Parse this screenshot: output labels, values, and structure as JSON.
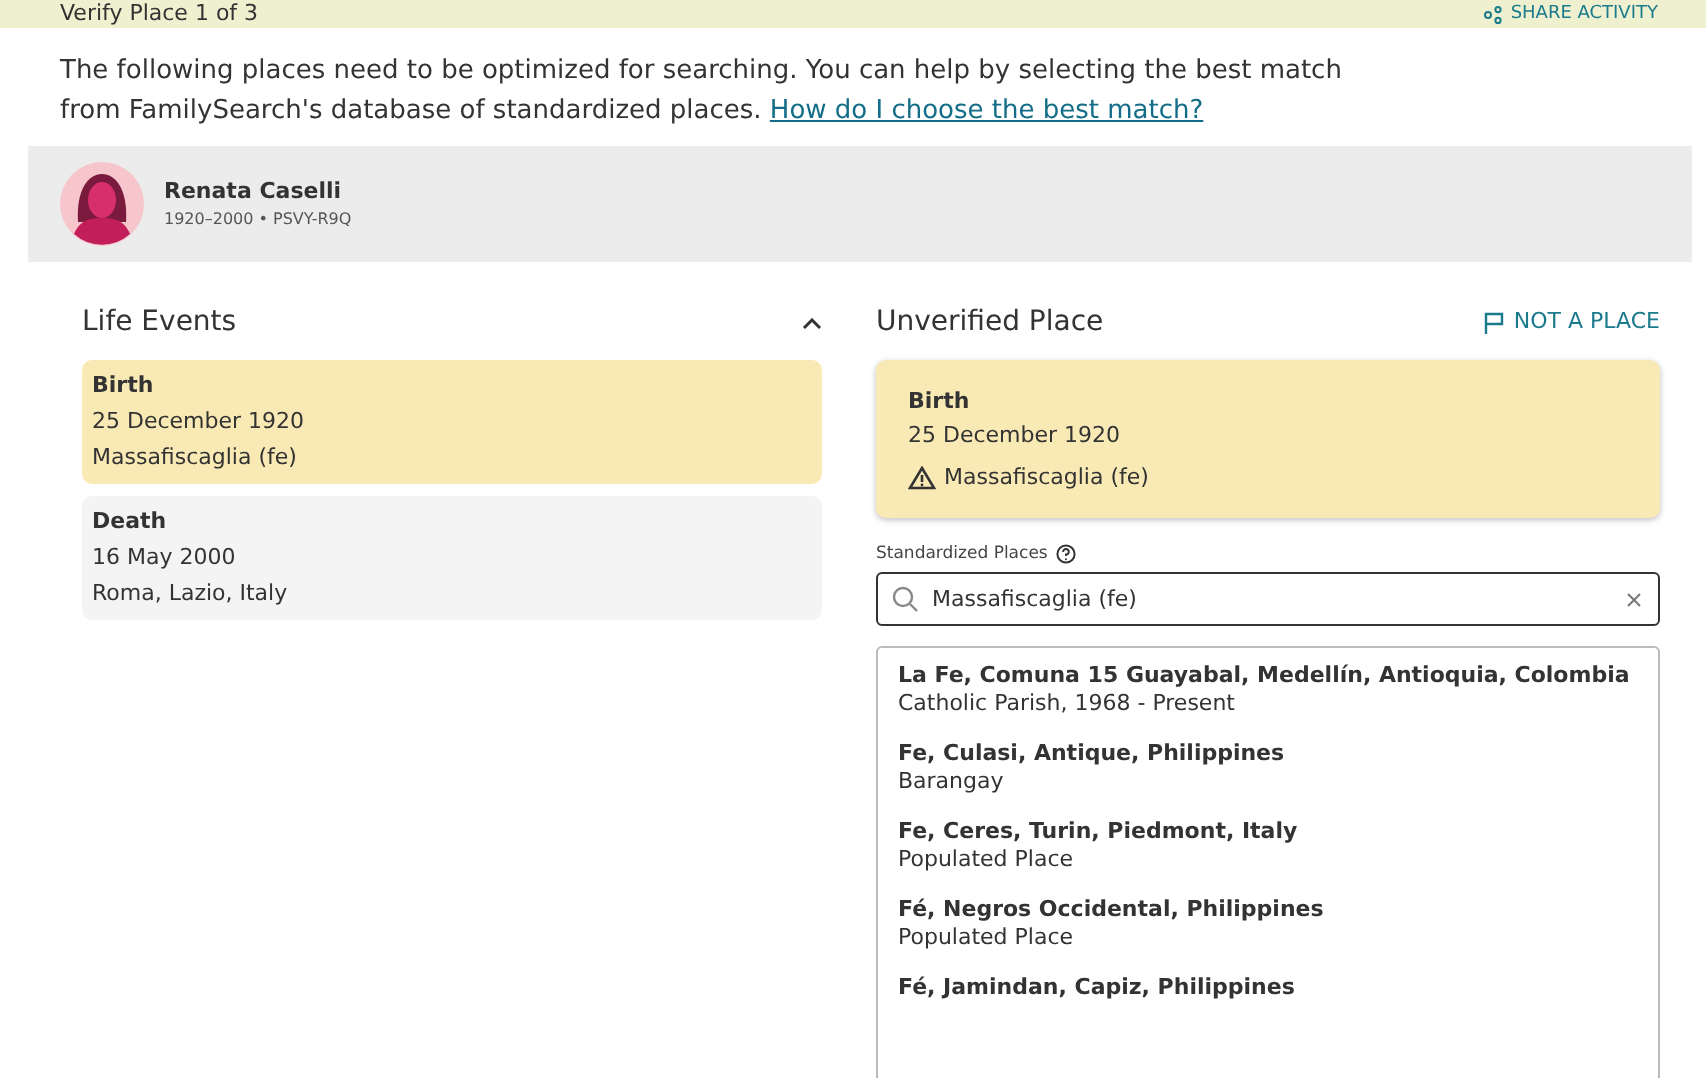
{
  "header": {
    "title": "Verify Place 1 of 3",
    "action": "SHARE ACTIVITY"
  },
  "intro": {
    "text": "The following places need to be optimized for searching. You can help by selecting the best match from FamilySearch's database of standardized places.",
    "link": "How do I choose the best match?"
  },
  "person": {
    "name": "Renata Caselli",
    "details": "1920–2000 • PSVY-R9Q"
  },
  "life_events": {
    "title": "Life Events",
    "expanded": true,
    "items": [
      {
        "type": "Birth",
        "date": "25 December 1920",
        "place": "Massafiscaglia (fe)",
        "selected": true
      },
      {
        "type": "Death",
        "date": "16 May 2000",
        "place": "Roma, Lazio, Italy",
        "selected": false
      }
    ]
  },
  "unverified": {
    "title": "Unverified Place",
    "action": "NOT A PLACE",
    "event": "Birth",
    "date": "25 December 1920",
    "place": "Massafiscaglia (fe)",
    "warning": true
  },
  "search": {
    "label": "Standardized Places",
    "value": "Massafiscaglia (fe)"
  },
  "results": [
    {
      "name": "La Fe, Comuna 15 Guayabal, Medellín, Antioquia, Colombia",
      "type": "Catholic Parish, 1968 - Present"
    },
    {
      "name": "Fe, Culasi, Antique, Philippines",
      "type": "Barangay"
    },
    {
      "name": "Fe, Ceres, Turin, Piedmont, Italy",
      "type": "Populated Place"
    },
    {
      "name": "Fé, Negros Occidental, Philippines",
      "type": "Populated Place"
    },
    {
      "name": "Fé, Jamindan, Capiz, Philippines"
    }
  ]
}
